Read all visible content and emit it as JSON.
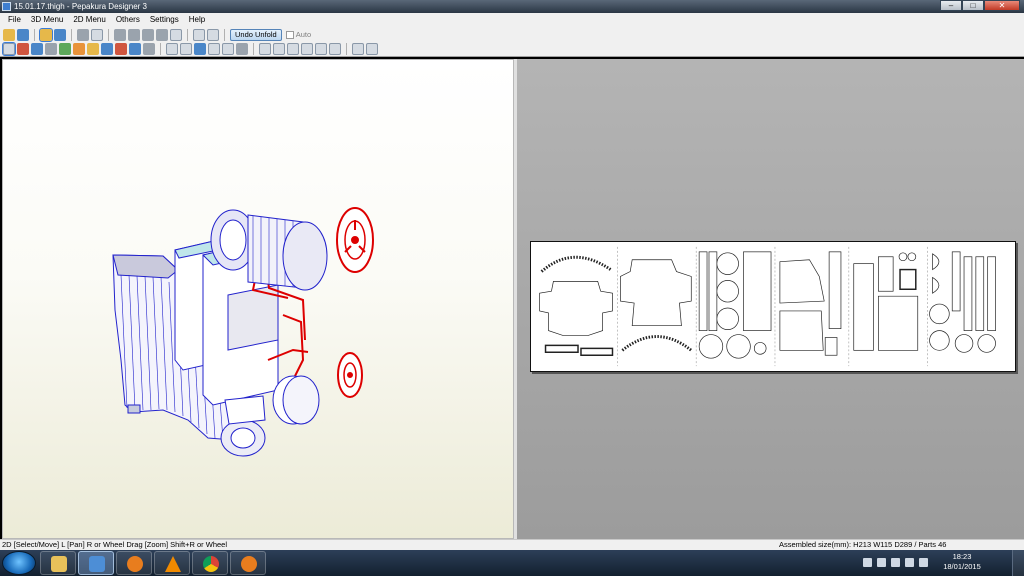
{
  "window": {
    "title": "15.01.17.thigh - Pepakura Designer 3",
    "minimize_label": "–",
    "maximize_label": "□",
    "close_label": "✕"
  },
  "menubar": {
    "items": [
      {
        "label": "File"
      },
      {
        "label": "3D Menu"
      },
      {
        "label": "2D Menu"
      },
      {
        "label": "Others"
      },
      {
        "label": "Settings"
      },
      {
        "label": "Help"
      }
    ]
  },
  "toolbar": {
    "undo_unfold_label": "Undo Unfold",
    "auto_label": "Auto",
    "auto_checked": false
  },
  "statusbar": {
    "left_text": "2D [Select/Move] L [Pan] R or Wheel Drag [Zoom] Shift+R or Wheel",
    "right_text": "Assembled size(mm): H213 W115 D289 / Parts 46"
  },
  "taskbar": {
    "apps": [
      {
        "icon": "file-explorer-icon"
      },
      {
        "icon": "pepakura-icon"
      },
      {
        "icon": "blender-icon"
      },
      {
        "icon": "vlc-icon"
      },
      {
        "icon": "chrome-icon"
      },
      {
        "icon": "blender-icon"
      }
    ],
    "clock_time": "18:23",
    "clock_date": "18/01/2015"
  },
  "colors": {
    "model_outline": "#2222cc",
    "highlight_red": "#dd0000",
    "face_fill": "#ffffff",
    "taskbar_bg": "#1c2b3e"
  }
}
